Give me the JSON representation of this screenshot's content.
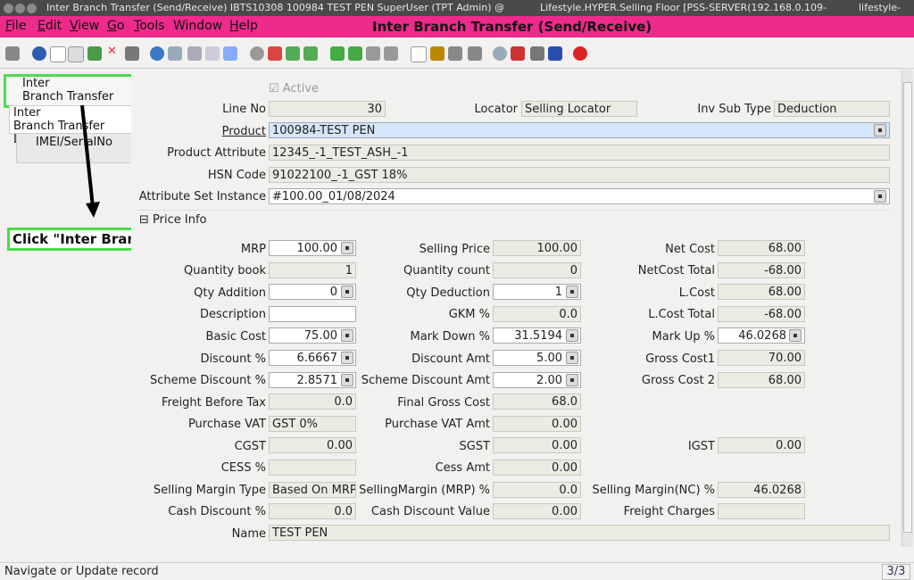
{
  "titlebar": {
    "left": "Inter Branch Transfer (Send/Receive)  IBTS10308  100984  TEST PEN  SuperUser (TPT Admin) @",
    "middle": "Lifestyle.HYPER.Selling Floor [PSS-SERVER(192.168.0.109-",
    "right": "lifestyle-"
  },
  "menu": {
    "items": [
      {
        "label": "File",
        "ul": "F",
        "rest": "ile"
      },
      {
        "label": "Edit",
        "ul": "E",
        "rest": "dit"
      },
      {
        "label": "View",
        "ul": "V",
        "rest": "iew"
      },
      {
        "label": "Go",
        "ul": "G",
        "rest": "o"
      },
      {
        "label": "Tools",
        "ul": "T",
        "rest": "ools"
      },
      {
        "label": "Window",
        "ul": "",
        "rest": "Window"
      },
      {
        "label": "Help",
        "ul": "H",
        "rest": "elp"
      }
    ],
    "window_title": "Inter Branch Transfer (Send/Receive)"
  },
  "tabs": {
    "tab1_line1": "Inter",
    "tab1_line2": "Branch Transfer",
    "tab2_line1": "Inter",
    "tab2_line2": "Branch Transfer Line",
    "tab3": "IMEI/SerialNo"
  },
  "callout": "Click \"Inter Branch Transfer\" Tab",
  "form": {
    "active": "Active",
    "line_no_label": "Line No",
    "line_no": "30",
    "locator_label": "Locator",
    "locator": "Selling Locator",
    "inv_sub_type_label": "Inv Sub Type",
    "inv_sub_type": "Deduction",
    "product_label": "Product",
    "product": "100984-TEST PEN",
    "product_attr_label": "Product Attribute",
    "product_attr": "12345_-1_TEST_ASH_-1",
    "hsn_label": "HSN Code",
    "hsn": "91022100_-1_GST 18%",
    "asi_label": "Attribute Set Instance",
    "asi": "#100.00_01/08/2024",
    "price_info": "Price Info",
    "mrp_label": "MRP",
    "mrp": "100.00",
    "selling_price_label": "Selling Price",
    "selling_price": "100.00",
    "net_cost_label": "Net Cost",
    "net_cost": "68.00",
    "qty_book_label": "Quantity book",
    "qty_book": "1",
    "qty_count_label": "Quantity count",
    "qty_count": "0",
    "netcost_total_label": "NetCost Total",
    "netcost_total": "-68.00",
    "qty_add_label": "Qty Addition",
    "qty_add": "0",
    "qty_ded_label": "Qty Deduction",
    "qty_ded": "1",
    "lcost_label": "L.Cost",
    "lcost": "68.00",
    "desc_label": "Description",
    "desc": "",
    "gkm_label": "GKM %",
    "gkm": "0.0",
    "lcost_total_label": "L.Cost Total",
    "lcost_total": "-68.00",
    "basic_cost_label": "Basic Cost",
    "basic_cost": "75.00",
    "markdown_label": "Mark Down %",
    "markdown": "31.5194",
    "markup_label": "Mark Up %",
    "markup": "46.0268",
    "discount_pct_label": "Discount %",
    "discount_pct": "6.6667",
    "discount_amt_label": "Discount Amt",
    "discount_amt": "5.00",
    "gross_cost1_label": "Gross Cost1",
    "gross_cost1": "70.00",
    "scheme_pct_label": "Scheme Discount %",
    "scheme_pct": "2.8571",
    "scheme_amt_label": "Scheme Discount Amt",
    "scheme_amt": "2.00",
    "gross_cost2_label": "Gross Cost 2",
    "gross_cost2": "68.00",
    "freight_label": "Freight Before Tax",
    "freight": "0.0",
    "final_gross_label": "Final Gross Cost",
    "final_gross": "68.0",
    "pvat_label": "Purchase VAT",
    "pvat": "GST 0%",
    "pvat_amt_label": "Purchase VAT Amt",
    "pvat_amt": "0.00",
    "cgst_label": "CGST",
    "cgst": "0.00",
    "sgst_label": "SGST",
    "sgst": "0.00",
    "igst_label": "IGST",
    "igst": "0.00",
    "cess_label": "CESS %",
    "cess": "",
    "cess_amt_label": "Cess Amt",
    "cess_amt": "0.00",
    "sm_type_label": "Selling Margin Type",
    "sm_type": "Based On MRP",
    "sm_mrp_label": "SellingMargin (MRP) %",
    "sm_mrp": "0.0",
    "sm_nc_label": "Selling Margin(NC) %",
    "sm_nc": "46.0268",
    "cash_disc_label": "Cash Discount %",
    "cash_disc": "0.0",
    "cash_disc_val_label": "Cash Discount Value",
    "cash_disc_val": "0.00",
    "freight_charges_label": "Freight Charges",
    "freight_charges": "",
    "name_label": "Name",
    "name": "TEST PEN"
  },
  "status": {
    "text": "Navigate or Update record",
    "page": "3/3"
  }
}
